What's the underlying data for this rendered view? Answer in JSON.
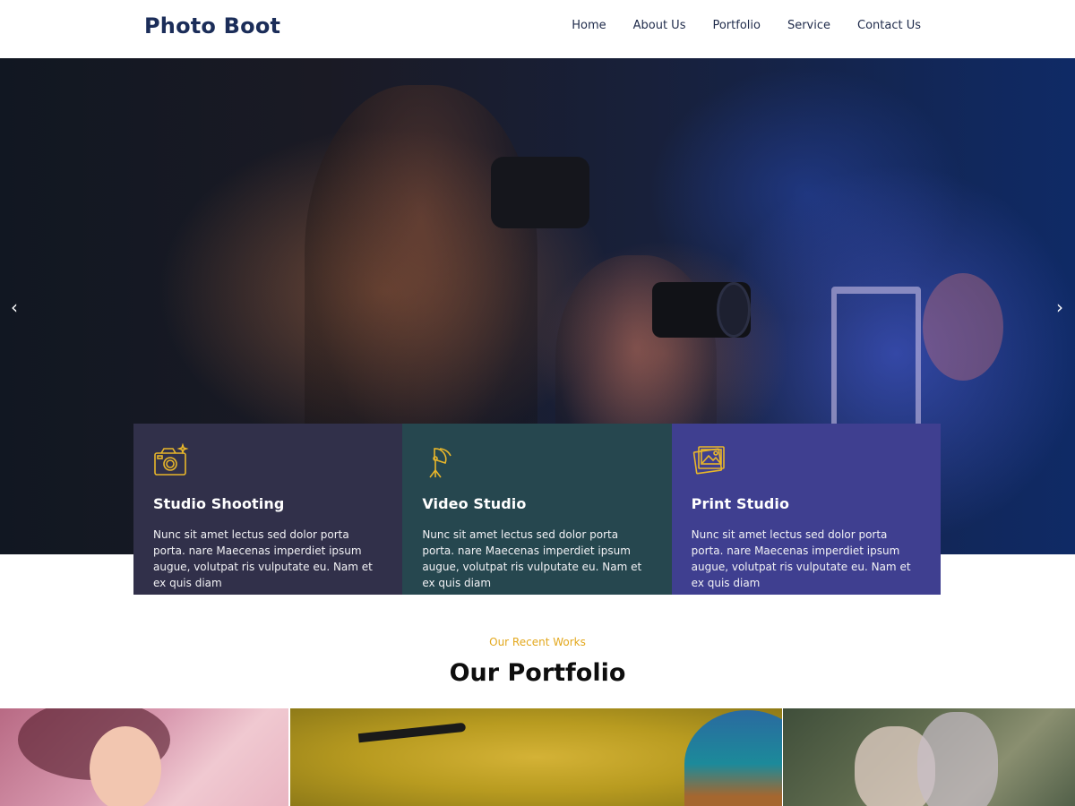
{
  "header": {
    "logo": "Photo Boot",
    "nav": [
      "Home",
      "About Us",
      "Portfolio",
      "Service",
      "Contact Us"
    ]
  },
  "hero": {
    "prev_arrow": "‹",
    "next_arrow": "›"
  },
  "services": [
    {
      "title": "Studio Shooting",
      "icon": "camera-icon",
      "text": "Nunc sit amet lectus sed dolor porta porta. nare Maecenas imperdiet ipsum augue, volutpat ris vulputate eu. Nam et ex quis diam",
      "color": "#31304a"
    },
    {
      "title": "Video Studio",
      "icon": "studio-light-icon",
      "text": "Nunc sit amet lectus sed dolor porta porta. nare Maecenas imperdiet ipsum augue, volutpat ris vulputate eu. Nam et ex quis diam",
      "color": "#26474f"
    },
    {
      "title": "Print Studio",
      "icon": "photo-print-icon",
      "text": "Nunc sit amet lectus sed dolor porta porta. nare Maecenas imperdiet ipsum augue, volutpat ris vulputate eu. Nam et ex quis diam",
      "color": "#3f3f90"
    }
  ],
  "portfolio": {
    "eyebrow": "Our Recent Works",
    "title": "Our Portfolio"
  },
  "colors": {
    "accent": "#e3a81e",
    "logo": "#1b2d59",
    "icon": "#e8b62a"
  }
}
